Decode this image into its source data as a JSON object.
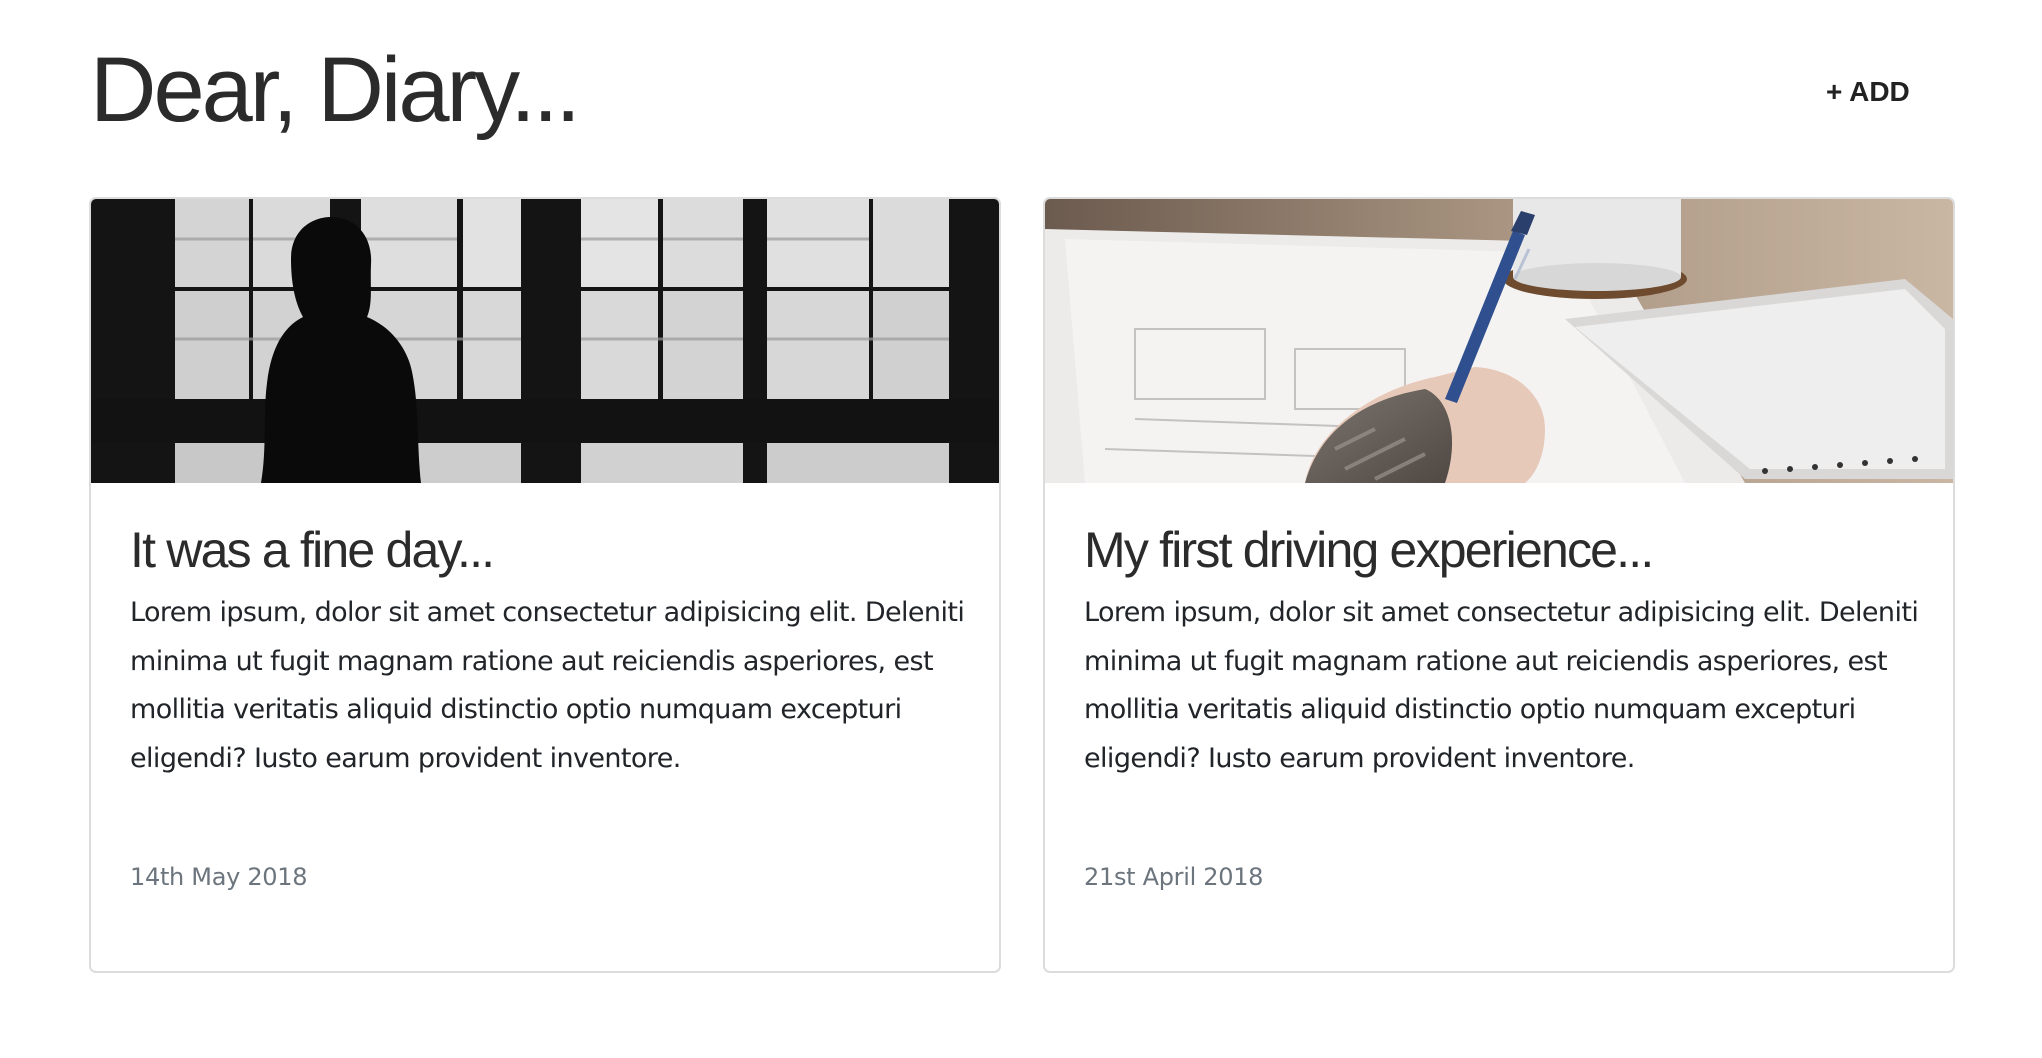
{
  "header": {
    "title": "Dear, Diary...",
    "add_label": "+ ADD"
  },
  "entries": [
    {
      "image": "woman-silhouette-window-photo",
      "title": "It was a fine day...",
      "body": "Lorem ipsum, dolor sit amet consectetur adipisicing elit. Deleniti minima ut fugit magnam ratione aut reiciendis asperiores, est mollitia veritatis aliquid distinctio optio numquam excepturi eligendi? Iusto earum provident inventore.",
      "date": "14th May 2018"
    },
    {
      "image": "hand-writing-with-pen-photo",
      "title": "My first driving experience...",
      "body": "Lorem ipsum, dolor sit amet consectetur adipisicing elit. Deleniti minima ut fugit magnam ratione aut reiciendis asperiores, est mollitia veritatis aliquid distinctio optio numquam excepturi eligendi? Iusto earum provident inventore.",
      "date": "21st April 2018"
    }
  ],
  "colors": {
    "background": "#ffffff",
    "card_border": "#dcdcdc",
    "title_text": "#2b2b2b",
    "body_text": "#212529",
    "date_text": "#6c757d"
  }
}
